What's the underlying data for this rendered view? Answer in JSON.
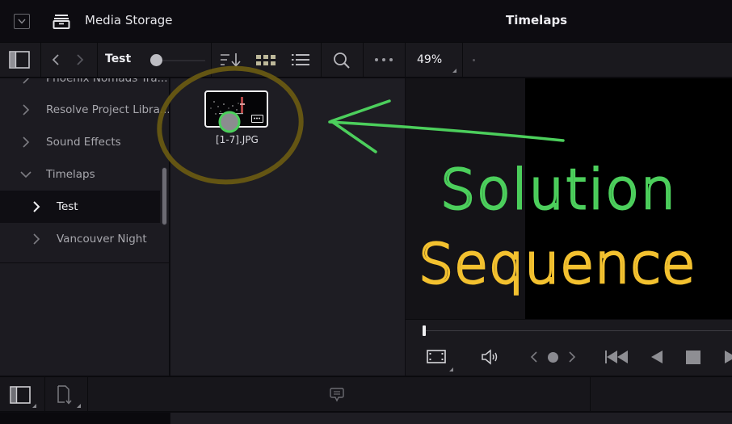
{
  "titlebar": {
    "left_title": "Media Storage",
    "right_title": "Timelaps"
  },
  "toolbar": {
    "breadcrumb": "Test",
    "thumbnail_size_fraction": 0.0,
    "zoom_level": "49%"
  },
  "sidebar": {
    "items": [
      {
        "label": "Phoenix Nomads Tra...",
        "expanded": false,
        "level": 0
      },
      {
        "label": "Resolve Project Libra...",
        "expanded": false,
        "level": 0
      },
      {
        "label": "Sound Effects",
        "expanded": false,
        "level": 0
      },
      {
        "label": "Timelaps",
        "expanded": true,
        "level": 0
      },
      {
        "label": "Test",
        "expanded": false,
        "level": 1,
        "selected": true
      },
      {
        "label": "Vancouver Night",
        "expanded": false,
        "level": 1
      }
    ]
  },
  "media_pool": {
    "clips": [
      {
        "name": "[1-7].JPG"
      }
    ]
  },
  "annotations": {
    "line1": "Solution",
    "line2": "Sequence",
    "line1_color": "#4ccf5c",
    "line2_color": "#f3c12f",
    "circle_color": "#7a6a10"
  },
  "transport": {
    "playhead_fraction": 0.0
  }
}
